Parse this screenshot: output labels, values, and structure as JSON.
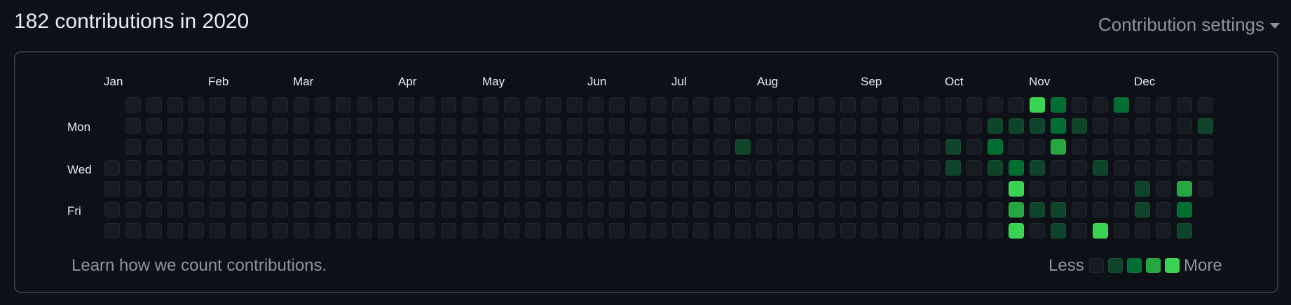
{
  "header": {
    "title": "182 contributions in 2020",
    "settings_label": "Contribution settings"
  },
  "calendar": {
    "months": [
      "Jan",
      "Feb",
      "Mar",
      "Apr",
      "May",
      "Jun",
      "Jul",
      "Aug",
      "Sep",
      "Oct",
      "Nov",
      "Dec"
    ],
    "weekday_labels": [
      "Mon",
      "Wed",
      "Fri"
    ],
    "level_colors": [
      "#161b22",
      "#0e4429",
      "#006d32",
      "#26a641",
      "#39d353"
    ],
    "active_cells": [
      {
        "week": 30,
        "day": 2,
        "level": 1
      },
      {
        "week": 40,
        "day": 2,
        "level": 1
      },
      {
        "week": 40,
        "day": 3,
        "level": 1
      },
      {
        "week": 42,
        "day": 1,
        "level": 1
      },
      {
        "week": 42,
        "day": 2,
        "level": 2
      },
      {
        "week": 42,
        "day": 3,
        "level": 1
      },
      {
        "week": 43,
        "day": 1,
        "level": 1
      },
      {
        "week": 43,
        "day": 3,
        "level": 2
      },
      {
        "week": 43,
        "day": 4,
        "level": 4
      },
      {
        "week": 43,
        "day": 5,
        "level": 3
      },
      {
        "week": 43,
        "day": 6,
        "level": 4
      },
      {
        "week": 44,
        "day": 0,
        "level": 4
      },
      {
        "week": 44,
        "day": 1,
        "level": 1
      },
      {
        "week": 44,
        "day": 3,
        "level": 1
      },
      {
        "week": 44,
        "day": 5,
        "level": 1
      },
      {
        "week": 45,
        "day": 0,
        "level": 2
      },
      {
        "week": 45,
        "day": 1,
        "level": 2
      },
      {
        "week": 45,
        "day": 2,
        "level": 3
      },
      {
        "week": 45,
        "day": 5,
        "level": 1
      },
      {
        "week": 45,
        "day": 6,
        "level": 1
      },
      {
        "week": 46,
        "day": 1,
        "level": 1
      },
      {
        "week": 47,
        "day": 3,
        "level": 1
      },
      {
        "week": 47,
        "day": 6,
        "level": 4
      },
      {
        "week": 48,
        "day": 0,
        "level": 2
      },
      {
        "week": 49,
        "day": 4,
        "level": 1
      },
      {
        "week": 49,
        "day": 5,
        "level": 1
      },
      {
        "week": 51,
        "day": 4,
        "level": 3
      },
      {
        "week": 51,
        "day": 5,
        "level": 2
      },
      {
        "week": 51,
        "day": 6,
        "level": 1
      },
      {
        "week": 52,
        "day": 1,
        "level": 1
      }
    ]
  },
  "footer": {
    "learn_link": "Learn how we count contributions.",
    "legend_less": "Less",
    "legend_more": "More"
  }
}
